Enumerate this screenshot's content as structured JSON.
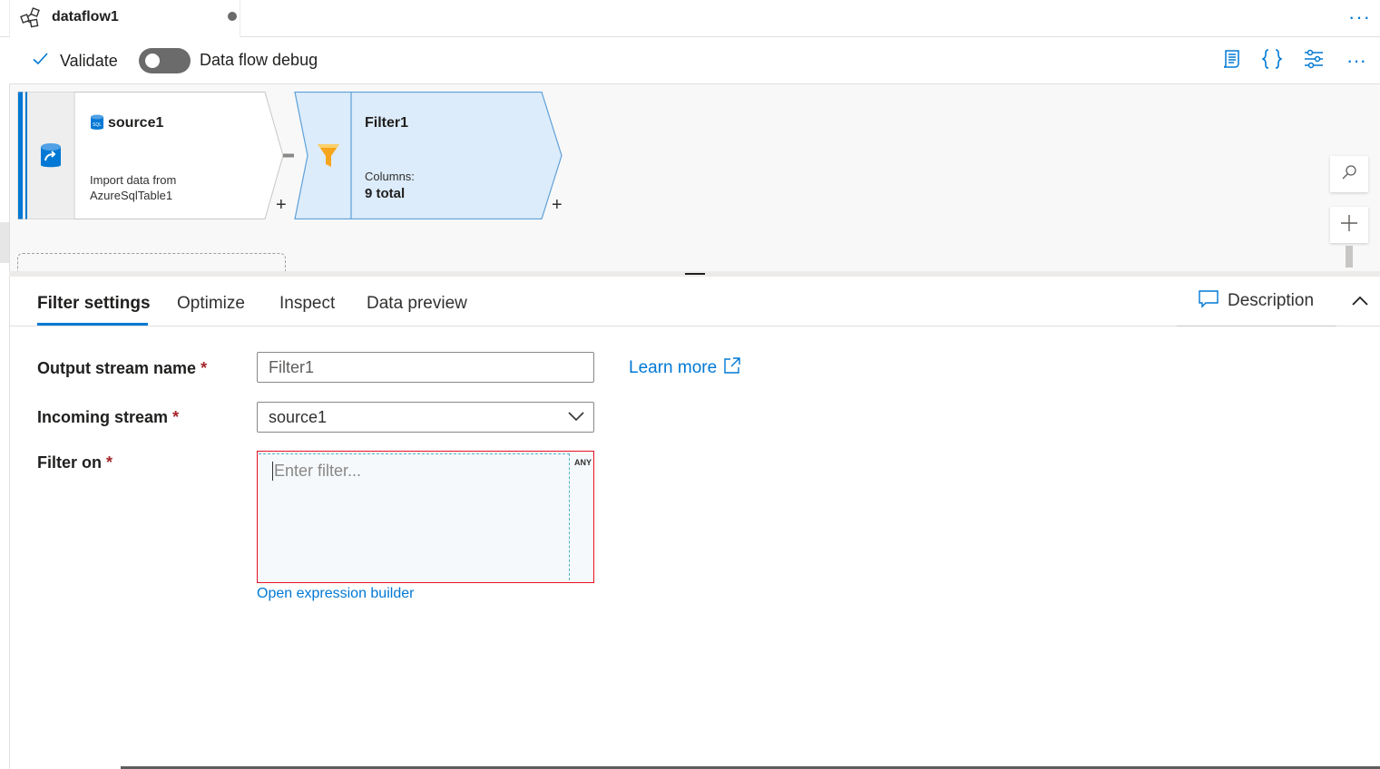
{
  "tab": {
    "title": "dataflow1",
    "more": "···"
  },
  "toolbar": {
    "validate": "Validate",
    "debug_label": "Data flow debug",
    "debug_on": false,
    "more": "···"
  },
  "icons": {
    "tab": "dataflow-icon",
    "validate": "checkmark-icon",
    "script": "script-icon",
    "code": "code-braces-icon",
    "settings": "settings-sliders-icon"
  },
  "canvas": {
    "source": {
      "name": "source1",
      "desc_line1": "Import data from",
      "desc_line2": "AzureSqlTable1",
      "plus": "+"
    },
    "filter": {
      "name": "Filter1",
      "columns_label": "Columns:",
      "columns_value": "9 total",
      "plus": "+"
    }
  },
  "panel": {
    "tabs": [
      "Filter settings",
      "Optimize",
      "Inspect",
      "Data preview"
    ],
    "active_tab": "Filter settings",
    "description": "Description",
    "fields": {
      "output_stream": {
        "label": "Output stream name",
        "required": "*",
        "value": "Filter1"
      },
      "incoming_stream": {
        "label": "Incoming stream",
        "required": "*",
        "value": "source1"
      },
      "filter_on": {
        "label": "Filter on",
        "required": "*",
        "placeholder": "Enter filter...",
        "type_badge": "ANY"
      }
    },
    "learn_more": "Learn more",
    "expression_builder": "Open expression builder"
  },
  "colors": {
    "accent": "#0078d4",
    "node_selected": "#dcecfa",
    "error": "#e81123",
    "required": "#a4262c"
  }
}
